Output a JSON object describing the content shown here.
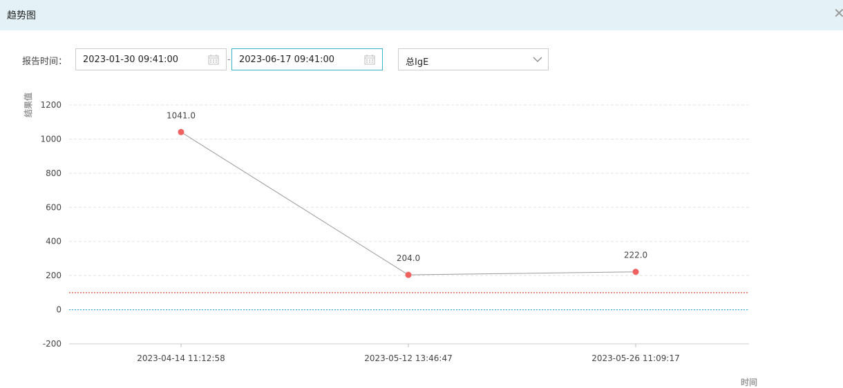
{
  "window": {
    "title": "趋势图",
    "close_glyph": "✕"
  },
  "filters": {
    "label": "报告时间：",
    "start_date": "2023-01-30 09:41:00",
    "end_date": "2023-06-17 09:41:00",
    "separator": "-",
    "item_select": "总IgE",
    "calendar_icon": "calendar-icon",
    "dropdown_icon": "chevron-down-icon"
  },
  "chart_data": {
    "type": "line",
    "xlabel": "时间",
    "ylabel": "结果值",
    "ylim": [
      -200,
      1200
    ],
    "yticks": [
      1200,
      1000,
      800,
      600,
      400,
      200,
      0,
      -200
    ],
    "categories": [
      "2023-04-14 11:12:58",
      "2023-05-12 13:46:47",
      "2023-05-26 11:09:17"
    ],
    "values": [
      1041.0,
      204.0,
      222.0
    ],
    "value_labels": [
      "1041.0",
      "204.0",
      "222.0"
    ],
    "reference_lines": [
      {
        "value": 100,
        "color": "#e8452f",
        "style": "dotted"
      },
      {
        "value": 0,
        "color": "#33a8d4",
        "style": "dotted"
      }
    ],
    "grid": true,
    "colors": {
      "line": "#999999",
      "point": "#f0625f",
      "grid": "#e3e3e3"
    }
  }
}
